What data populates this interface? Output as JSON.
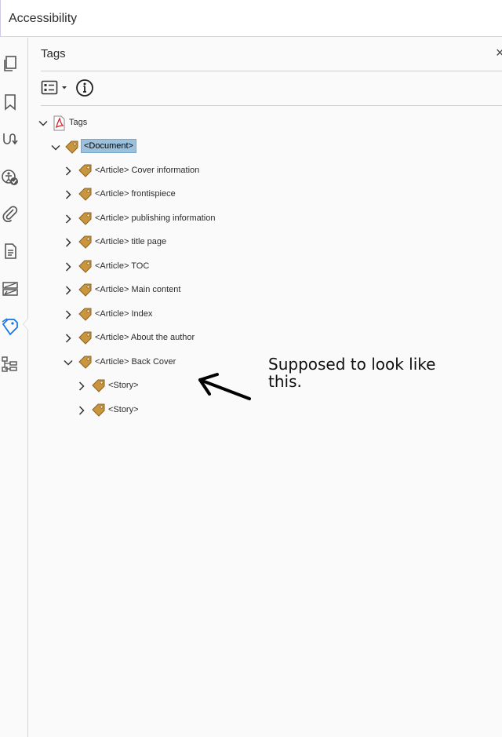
{
  "header": {
    "title": "Accessibility"
  },
  "left_rail": {
    "icons": [
      "pages-icon",
      "bookmark-icon",
      "signatures-icon",
      "accessibility-check-icon",
      "attachments-icon",
      "content-icon",
      "order-icon",
      "tags-icon",
      "model-tree-icon"
    ],
    "active": "tags-icon"
  },
  "panel": {
    "title": "Tags",
    "close": "×",
    "toolbar": {
      "options_icon": "options-menu-icon",
      "info_icon": "info-icon"
    }
  },
  "tree": {
    "root": "Tags",
    "document": "<Document>",
    "articles": [
      "<Article> Cover information",
      "<Article> frontispiece",
      "<Article> publishing information",
      "<Article> title page",
      "<Article> TOC",
      "<Article> Main content",
      "<Article> Index",
      "<Article> About the author",
      "<Article> Back Cover"
    ],
    "stories": [
      "<Story>",
      "<Story>"
    ]
  },
  "annotation": {
    "text": "Supposed to look like this."
  },
  "colors": {
    "selection": "#9cc1dd",
    "tag_gold": "#c9963d",
    "active_icon": "#1473e6"
  }
}
